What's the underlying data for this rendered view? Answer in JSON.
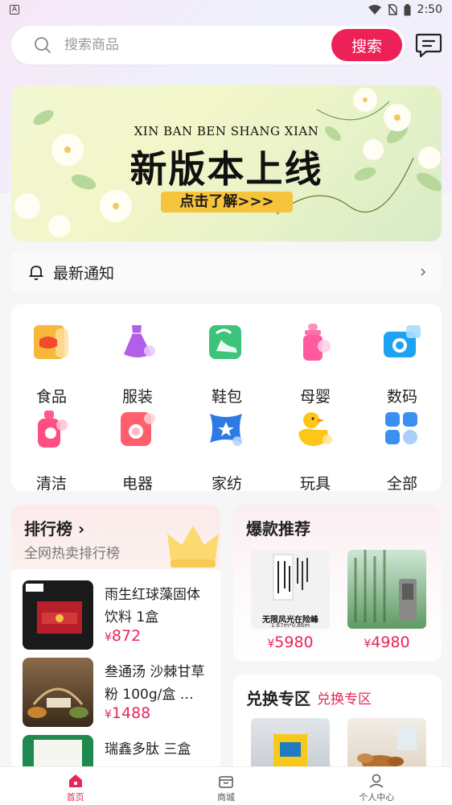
{
  "status_bar": {
    "time": "2:50"
  },
  "search": {
    "placeholder": "搜索商品",
    "button_label": "搜索"
  },
  "banner": {
    "subtitle": "XIN BAN BEN SHANG XIAN",
    "title": "新版本上线",
    "cta": "点击了解>>>"
  },
  "notice": {
    "label": "最新通知"
  },
  "categories": [
    {
      "label": "食品",
      "icon": "food-bag-icon"
    },
    {
      "label": "服装",
      "icon": "dress-icon"
    },
    {
      "label": "鞋包",
      "icon": "shoe-bag-icon"
    },
    {
      "label": "母婴",
      "icon": "baby-bottle-icon"
    },
    {
      "label": "数码",
      "icon": "camera-icon"
    },
    {
      "label": "清洁",
      "icon": "cleaning-bottle-icon"
    },
    {
      "label": "电器",
      "icon": "washing-machine-icon"
    },
    {
      "label": "家纺",
      "icon": "pillow-icon"
    },
    {
      "label": "玩具",
      "icon": "duck-toy-icon"
    },
    {
      "label": "全部",
      "icon": "grid-all-icon"
    }
  ],
  "ranking": {
    "title": "排行榜",
    "subtitle": "全网热卖排行榜",
    "items": [
      {
        "name": "雨生红球藻固体饮料 1盒",
        "currency": "¥",
        "price": "872"
      },
      {
        "name": "叁通汤 沙棘甘草粉 100g/盒 …",
        "currency": "¥",
        "price": "1488"
      },
      {
        "name": "瑞鑫多肽 三盒",
        "currency": "¥",
        "price": ""
      }
    ]
  },
  "hot": {
    "title": "爆款推荐",
    "items": [
      {
        "currency": "¥",
        "price": "5980",
        "caption": "无限风光在险峰",
        "size": "1.67m*0.86m"
      },
      {
        "currency": "¥",
        "price": "4980"
      }
    ]
  },
  "exchange": {
    "title": "兑换专区",
    "tag": "兑换专区"
  },
  "tabbar": [
    {
      "label": "首页",
      "icon": "home-icon",
      "active": true
    },
    {
      "label": "商城",
      "icon": "shop-icon",
      "active": false
    },
    {
      "label": "个人中心",
      "icon": "user-icon",
      "active": false
    }
  ],
  "colors": {
    "accent": "#ee2058",
    "price": "#e8265b",
    "cta": "#f6c33c"
  }
}
